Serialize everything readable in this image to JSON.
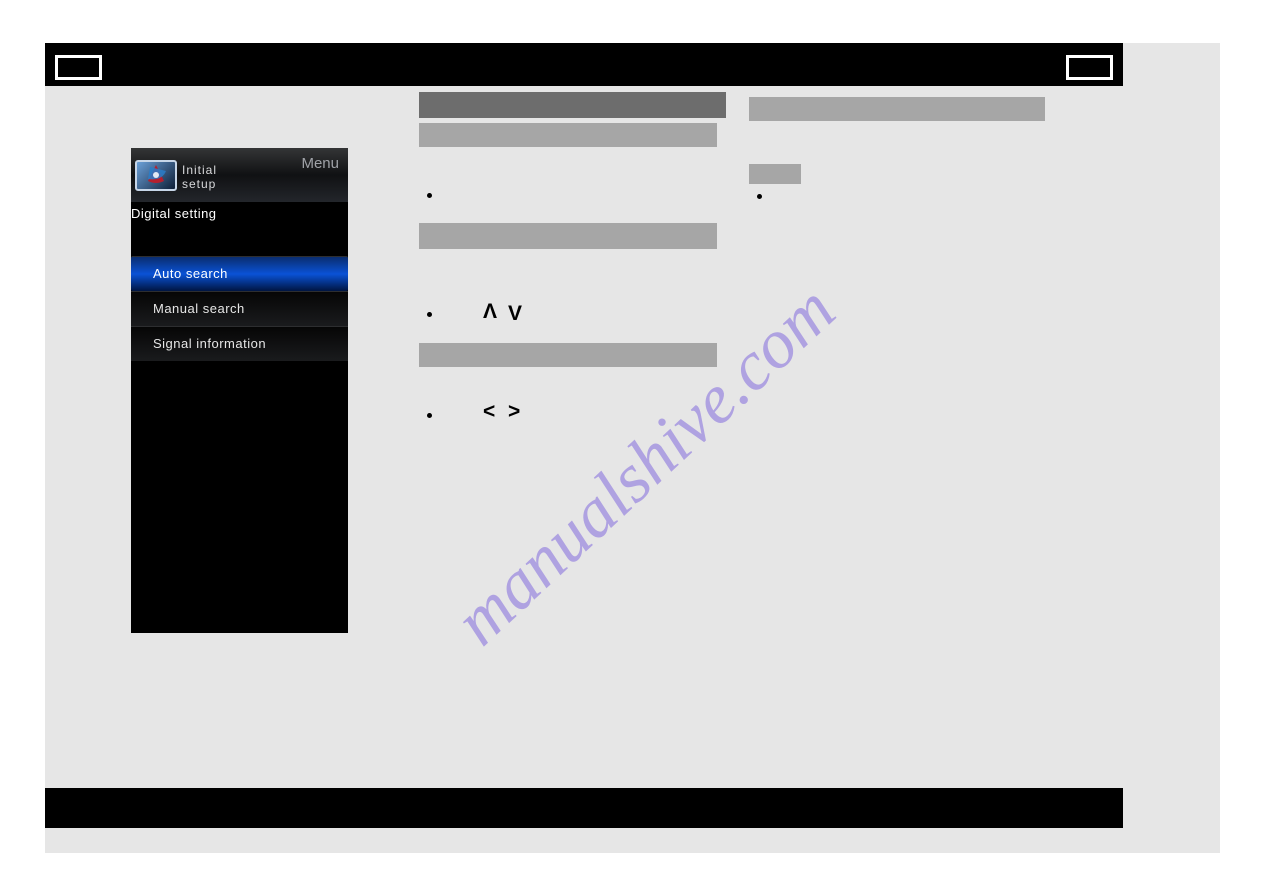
{
  "tv_menu": {
    "head_line1": "Initial",
    "head_line2": "setup",
    "menu_label": "Menu",
    "section": "Digital setting",
    "items": [
      "Auto search",
      "Manual search",
      "Signal information"
    ],
    "selected_index": 0
  },
  "watermark": "manualshive.com",
  "arrows": {
    "up": "Λ",
    "down": "V",
    "left": "<",
    "right": ">"
  }
}
